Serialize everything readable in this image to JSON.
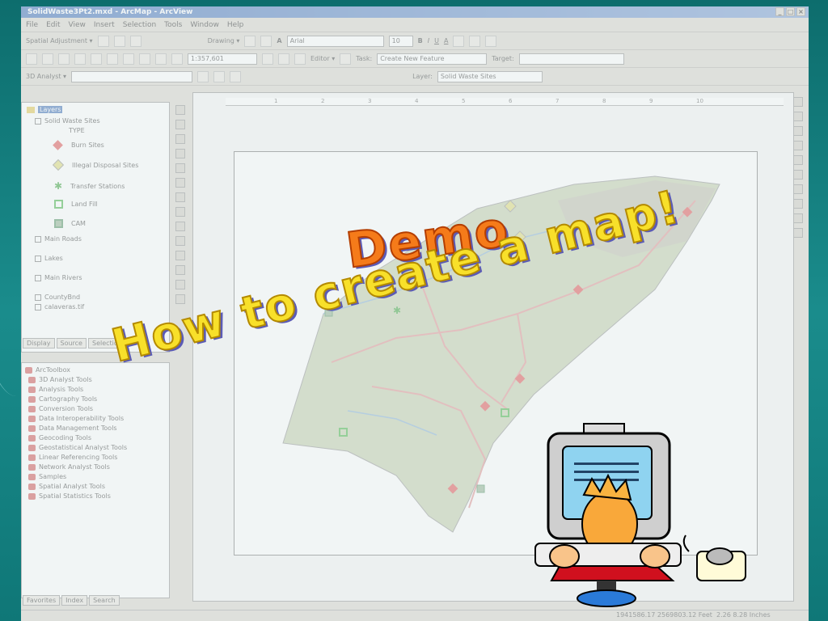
{
  "window": {
    "title": "SolidWaste3Pt2.mxd - ArcMap - ArcView",
    "controls": [
      "_",
      "□",
      "×"
    ]
  },
  "menu": [
    "File",
    "Edit",
    "View",
    "Insert",
    "Selection",
    "Tools",
    "Window",
    "Help"
  ],
  "toolbar1": {
    "spatial_adjustment": "Spatial Adjustment ▾",
    "drawing": "Drawing ▾",
    "font": "Arial",
    "font_size": "10",
    "bold": "B",
    "italic": "I",
    "underline": "U",
    "font_color": "A"
  },
  "toolbar2": {
    "scale": "1:357,601",
    "editor": "Editor ▾",
    "task_label": "Task:",
    "task": "Create New Feature",
    "target_label": "Target:"
  },
  "toolbar3": {
    "analyst": "3D Analyst ▾",
    "layer_label": "Layer:",
    "layer": "Solid Waste Sites"
  },
  "toc": {
    "root": "Layers",
    "items": [
      {
        "label": "Solid Waste Sites"
      },
      {
        "label": "TYPE"
      },
      {
        "label": "Burn Sites"
      },
      {
        "label": "Illegal Disposal Sites"
      },
      {
        "label": "Transfer Stations"
      },
      {
        "label": "Land Fill"
      },
      {
        "label": "CAM"
      },
      {
        "label": "Main Roads"
      },
      {
        "label": "Lakes"
      },
      {
        "label": "Main Rivers"
      },
      {
        "label": "CountyBnd"
      },
      {
        "label": "calaveras.tif"
      }
    ],
    "tabs": [
      "Display",
      "Source",
      "Selection"
    ]
  },
  "toolbox": {
    "root": "ArcToolbox",
    "items": [
      "3D Analyst Tools",
      "Analysis Tools",
      "Cartography Tools",
      "Conversion Tools",
      "Data Interoperability Tools",
      "Data Management Tools",
      "Geocoding Tools",
      "Geostatistical Analyst Tools",
      "Linear Referencing Tools",
      "Network Analyst Tools",
      "Samples",
      "Spatial Analyst Tools",
      "Spatial Statistics Tools"
    ],
    "tabs": [
      "Favorites",
      "Index",
      "Search"
    ]
  },
  "ruler": [
    "1",
    "2",
    "3",
    "4",
    "5",
    "6",
    "7",
    "8",
    "9",
    "10"
  ],
  "status": {
    "coords": "1941586.17  2569803.12 Feet",
    "page": "2.26  8.28 Inches"
  },
  "overlay": {
    "title": "Demo",
    "subtitle": "How to create a map!"
  },
  "colors": {
    "title_orange": "#f57b1a",
    "subtitle_yellow": "#f8e02a",
    "background_teal": "#1a8c8c"
  }
}
